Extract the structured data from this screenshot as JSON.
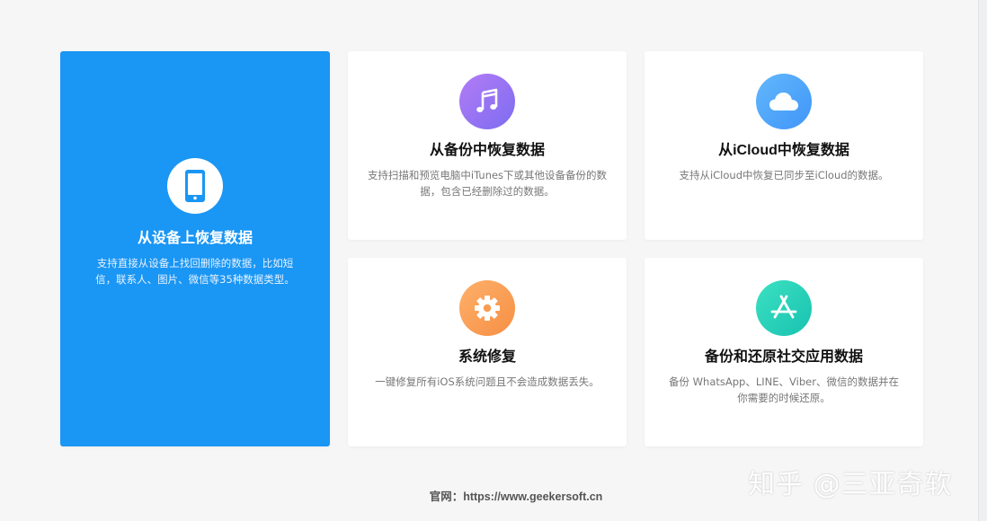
{
  "cards": [
    {
      "title": "从设备上恢复数据",
      "desc": "支持直接从设备上找回删除的数据，比如短信，联系人、图片、微信等35种数据类型。",
      "icon": "phone-icon",
      "bg": "#1a96f4"
    },
    {
      "title": "从备份中恢复数据",
      "desc": "支持扫描和预览电脑中iTunes下或其他设备备份的数据，包含已经删除过的数据。",
      "icon": "music-note-icon"
    },
    {
      "title": "从iCloud中恢复数据",
      "desc": "支持从iCloud中恢复已同步至iCloud的数据。",
      "icon": "cloud-icon"
    },
    {
      "title": "系统修复",
      "desc": "一键修复所有iOS系统问题且不会造成数据丢失。",
      "icon": "gear-icon"
    },
    {
      "title": "备份和还原社交应用数据",
      "desc": "备份 WhatsApp、LINE、Viber、微信的数据并在你需要的时候还原。",
      "icon": "app-store-icon"
    }
  ],
  "footer": "官网：https://www.geekersoft.cn",
  "watermark": "知乎 @三亚奇软"
}
